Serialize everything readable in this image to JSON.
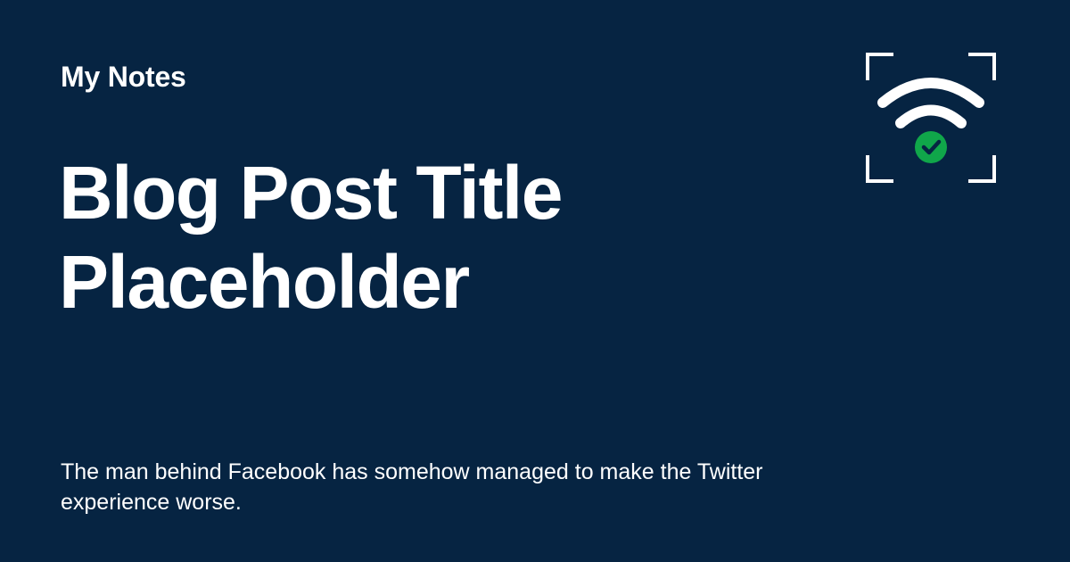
{
  "site": {
    "name": "My Notes"
  },
  "post": {
    "title": "Blog Post Title Placeholder",
    "description": "The man behind Facebook has somehow managed to make the Twitter experience worse."
  },
  "logo": {
    "icon": "wifi-check-icon"
  },
  "colors": {
    "background": "#062442",
    "text": "#ffffff",
    "accent": "#10a64a"
  }
}
